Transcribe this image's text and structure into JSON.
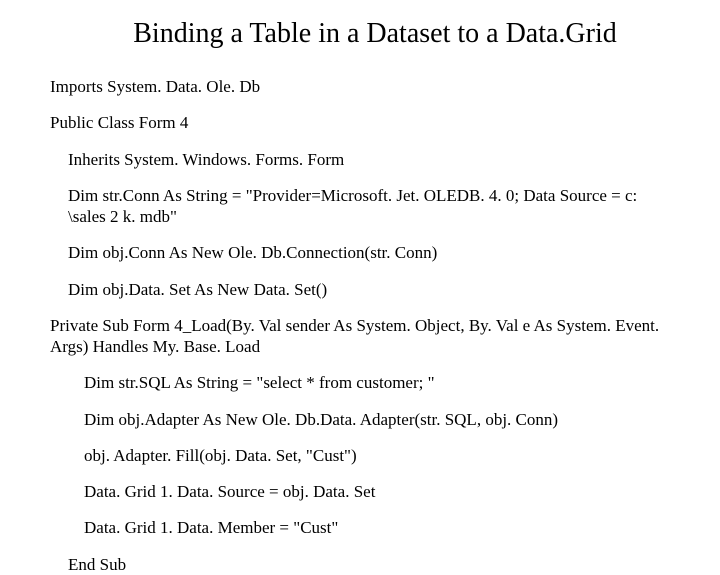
{
  "title": "Binding a Table in a Dataset to a Data.Grid",
  "lines": {
    "l0": "Imports System. Data. Ole. Db",
    "l1": "Public Class Form 4",
    "l2": "Inherits System. Windows. Forms. Form",
    "l3": "Dim str.Conn As String = \"Provider=Microsoft. Jet. OLEDB. 4. 0; Data Source = c: \\sales 2 k. mdb\"",
    "l4": "Dim obj.Conn As New Ole. Db.Connection(str. Conn)",
    "l5": "Dim obj.Data. Set As New Data. Set()",
    "l6": "Private Sub Form 4_Load(By. Val sender As System. Object, By. Val e As System. Event. Args) Handles My. Base. Load",
    "l7": "Dim str.SQL As String = \"select * from customer; \"",
    "l8": "Dim obj.Adapter As New Ole. Db.Data. Adapter(str. SQL, obj. Conn)",
    "l9": "obj. Adapter. Fill(obj. Data. Set, \"Cust\")",
    "l10": "Data. Grid 1. Data. Source = obj. Data. Set",
    "l11": "Data. Grid 1. Data. Member = \"Cust\"",
    "l12": "End Sub"
  }
}
